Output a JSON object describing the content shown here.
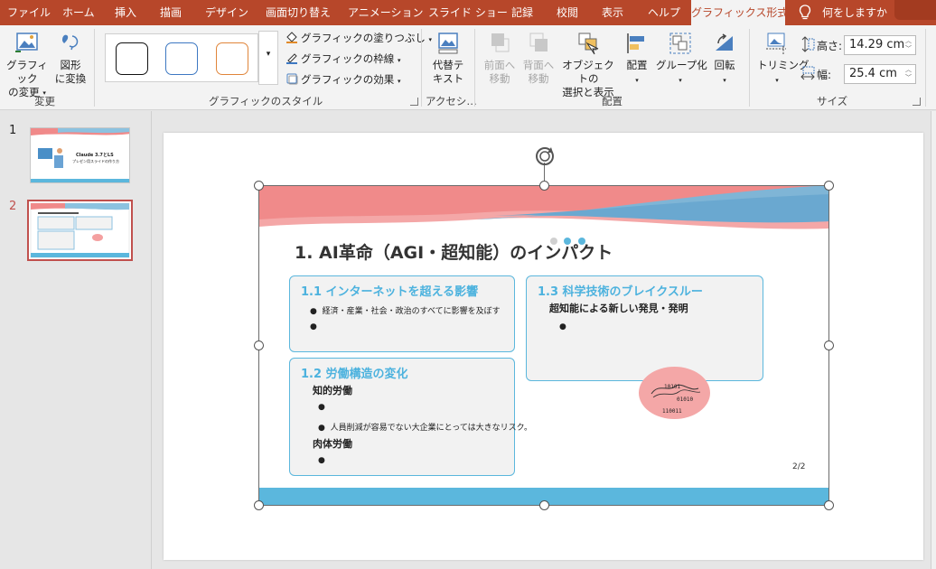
{
  "tabs": [
    {
      "label": "ファイル"
    },
    {
      "label": "ホーム"
    },
    {
      "label": "挿入"
    },
    {
      "label": "描画"
    },
    {
      "label": "デザイン"
    },
    {
      "label": "画面切り替え"
    },
    {
      "label": "アニメーション"
    },
    {
      "label": "スライド ショー"
    },
    {
      "label": "記録"
    },
    {
      "label": "校閲"
    },
    {
      "label": "表示"
    },
    {
      "label": "ヘルプ"
    },
    {
      "label": "グラフィックス形式"
    }
  ],
  "tell_me": "何をしますか",
  "ribbon": {
    "change_group": {
      "label": "変更",
      "change_graphic": "グラフィック\nの変更",
      "convert_shape": "図形\nに変換"
    },
    "styles_group": {
      "label": "グラフィックのスタイル",
      "fill": "グラフィックの塗りつぶし",
      "outline": "グラフィックの枠線",
      "effects": "グラフィックの効果"
    },
    "access_group": {
      "label": "アクセシ…",
      "alt_text": "代替テ\nキスト"
    },
    "arrange_group": {
      "label": "配置",
      "bring_forward": "前面へ\n移動",
      "send_backward": "背面へ\n移動",
      "selection_pane": "オブジェクトの\n選択と表示",
      "align": "配置",
      "group": "グループ化",
      "rotate": "回転"
    },
    "size_group": {
      "label": "サイズ",
      "crop": "トリミング",
      "height_label": "高さ:",
      "height_value": "14.29 cm",
      "width_label": "幅:",
      "width_value": "25.4 cm"
    }
  },
  "thumbnails": [
    {
      "number": "1",
      "title_line1": "Claude 3.7とLS",
      "title_line2": "プレゼン用スライドの作り方"
    },
    {
      "number": "2"
    }
  ],
  "slide": {
    "title": "1. AI革命（AGI・超知能）のインパクト",
    "cards": {
      "c11": {
        "title": "1.1 インターネットを超える影響",
        "bullets": [
          "経済・産業・社会・政治のすべてに影響を及ぼす",
          ""
        ]
      },
      "c12": {
        "title": "1.2 労働構造の変化",
        "sub1": "知的労働",
        "bullets1": [
          "",
          "人員削減が容易でない大企業にとっては大きなリスク。"
        ],
        "sub2": "肉体労働",
        "bullets2": [
          ""
        ]
      },
      "c13": {
        "title": "1.3 科学技術のブレイクスルー",
        "sub1": "超知能による新しい発見・発明",
        "bullets": [
          ""
        ]
      }
    },
    "binary": [
      "10101",
      "01010",
      "110011"
    ],
    "page_number": "2/2"
  },
  "colors": {
    "accent": "#b7472a",
    "slide_blue": "#5bb7dd",
    "slide_pink": "#f08a8a"
  }
}
